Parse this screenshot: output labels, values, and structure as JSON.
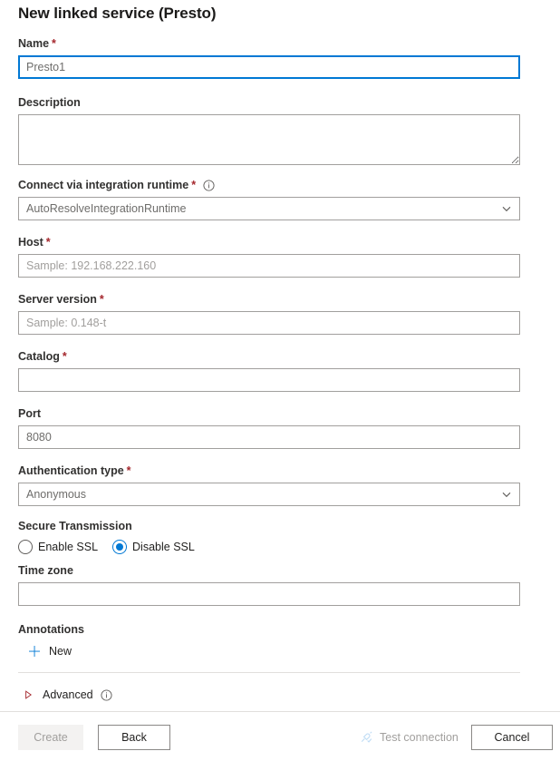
{
  "page": {
    "title": "New linked service (Presto)"
  },
  "fields": {
    "name": {
      "label": "Name",
      "required": "*",
      "value": "Presto1",
      "placeholder": ""
    },
    "description": {
      "label": "Description",
      "value": "",
      "placeholder": ""
    },
    "integration_runtime": {
      "label": "Connect via integration runtime",
      "required": "*",
      "value": "AutoResolveIntegrationRuntime",
      "info_icon": "info-icon",
      "chevron_icon": "chevron-down-icon"
    },
    "host": {
      "label": "Host",
      "required": "*",
      "value": "",
      "placeholder": "Sample: 192.168.222.160"
    },
    "server_version": {
      "label": "Server version",
      "required": "*",
      "value": "",
      "placeholder": "Sample: 0.148-t"
    },
    "catalog": {
      "label": "Catalog",
      "required": "*",
      "value": "",
      "placeholder": ""
    },
    "port": {
      "label": "Port",
      "required": "",
      "value": "8080",
      "placeholder": ""
    },
    "authentication_type": {
      "label": "Authentication type",
      "required": "*",
      "value": "Anonymous",
      "chevron_icon": "chevron-down-icon"
    },
    "secure_transmission": {
      "label": "Secure Transmission",
      "options": [
        {
          "label": "Enable SSL",
          "selected": false
        },
        {
          "label": "Disable SSL",
          "selected": true
        }
      ]
    },
    "time_zone": {
      "label": "Time zone",
      "value": "",
      "placeholder": ""
    }
  },
  "annotations": {
    "label": "Annotations",
    "new_label": "New",
    "plus_icon": "plus-icon"
  },
  "advanced": {
    "label": "Advanced",
    "expander_icon": "triangle-right-icon",
    "info_icon": "info-icon"
  },
  "footer": {
    "create_label": "Create",
    "back_label": "Back",
    "test_connection_label": "Test connection",
    "test_connection_icon": "plug-icon",
    "cancel_label": "Cancel"
  },
  "colors": {
    "accent": "#0078d4",
    "required_asterisk": "#a4262c",
    "border": "#a19f9d",
    "disabled_text": "#a19f9d",
    "divider": "#e1dfdd"
  }
}
